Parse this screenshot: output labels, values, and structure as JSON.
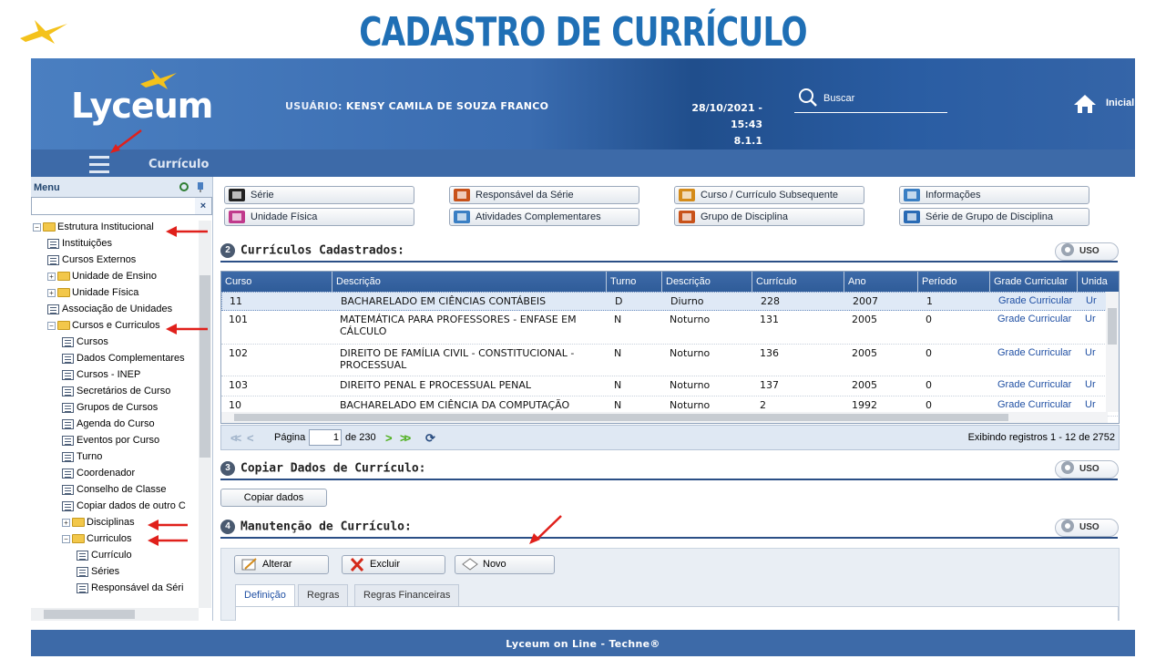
{
  "slide": {
    "title": "CADASTRO DE CURRÍCULO"
  },
  "header": {
    "brand": "Lyceum",
    "user_label": "USUÁRIO:",
    "user_name": "KENSY CAMILA DE SOUZA FRANCO",
    "datetime": "28/10/2021 - 15:43",
    "version": "8.1.1",
    "search_label": "Buscar",
    "home_label": "Inicial"
  },
  "subbar": {
    "title": "Currículo"
  },
  "sidebar": {
    "menu_label": "Menu",
    "clear_label": "×",
    "tree": [
      {
        "label": "Estrutura Institucional",
        "type": "folder",
        "level": 0,
        "expanded": true
      },
      {
        "label": "Instituições",
        "type": "doc",
        "level": 1
      },
      {
        "label": "Cursos Externos",
        "type": "doc",
        "level": 1
      },
      {
        "label": "Unidade de Ensino",
        "type": "folder",
        "level": 1,
        "expanded": false
      },
      {
        "label": "Unidade Física",
        "type": "folder",
        "level": 1,
        "expanded": false
      },
      {
        "label": "Associação de Unidades",
        "type": "doc",
        "level": 1
      },
      {
        "label": "Cursos e Curriculos",
        "type": "folder",
        "level": 1,
        "expanded": true
      },
      {
        "label": "Cursos",
        "type": "doc",
        "level": 2
      },
      {
        "label": "Dados Complementares",
        "type": "doc",
        "level": 2
      },
      {
        "label": "Cursos - INEP",
        "type": "doc",
        "level": 2
      },
      {
        "label": "Secretários de Curso",
        "type": "doc",
        "level": 2
      },
      {
        "label": "Grupos de Cursos",
        "type": "doc",
        "level": 2
      },
      {
        "label": "Agenda do Curso",
        "type": "doc",
        "level": 2
      },
      {
        "label": "Eventos por Curso",
        "type": "doc",
        "level": 2
      },
      {
        "label": "Turno",
        "type": "doc",
        "level": 2
      },
      {
        "label": "Coordenador",
        "type": "doc",
        "level": 2
      },
      {
        "label": "Conselho de Classe",
        "type": "doc",
        "level": 2
      },
      {
        "label": "Copiar dados de outro C",
        "type": "doc",
        "level": 2
      },
      {
        "label": "Disciplinas",
        "type": "folder",
        "level": 2,
        "expanded": false
      },
      {
        "label": "Curriculos",
        "type": "folder",
        "level": 2,
        "expanded": true
      },
      {
        "label": "Currículo",
        "type": "doc",
        "level": 3
      },
      {
        "label": "Séries",
        "type": "doc",
        "level": 3
      },
      {
        "label": "Responsável da Séri",
        "type": "doc",
        "level": 3
      }
    ]
  },
  "toolbar": {
    "buttons": [
      {
        "label": "Série",
        "icon": "series-icon"
      },
      {
        "label": "Responsável da Série",
        "icon": "responsible-icon"
      },
      {
        "label": "Curso / Currículo Subsequente",
        "icon": "subsequent-icon"
      },
      {
        "label": "Informações",
        "icon": "info-icon"
      },
      {
        "label": "Unidade Física",
        "icon": "building-icon"
      },
      {
        "label": "Atividades Complementares",
        "icon": "activities-icon"
      },
      {
        "label": "Grupo de Disciplina",
        "icon": "book-group-icon"
      },
      {
        "label": "Série de Grupo de Disciplina",
        "icon": "numbered-icon"
      }
    ]
  },
  "sections": {
    "registered": {
      "num": "2",
      "title": "Currículos Cadastrados:"
    },
    "copy": {
      "num": "3",
      "title": "Copiar Dados de Currículo:",
      "button": "Copiar dados"
    },
    "maintenance": {
      "num": "4",
      "title": "Manutenção de Currículo:"
    },
    "uso_label": "USO"
  },
  "table": {
    "columns": [
      "Curso",
      "Descrição",
      "Turno",
      "Descrição",
      "Currículo",
      "Ano",
      "Período",
      "Grade Curricular",
      "Unida"
    ],
    "rows": [
      [
        "11",
        "BACHARELADO EM CIÊNCIAS CONTÁBEIS",
        "D",
        "Diurno",
        "228",
        "2007",
        "1",
        "Grade Curricular",
        "Ur"
      ],
      [
        "101",
        "MATEMÁTICA PARA PROFESSORES - ENFASE EM CÁLCULO",
        "N",
        "Noturno",
        "131",
        "2005",
        "0",
        "Grade Curricular",
        "Ur"
      ],
      [
        "102",
        "DIREITO DE FAMÍLIA CIVIL - CONSTITUCIONAL - PROCESSUAL",
        "N",
        "Noturno",
        "136",
        "2005",
        "0",
        "Grade Curricular",
        "Ur"
      ],
      [
        "103",
        "DIREITO PENAL E PROCESSUAL PENAL",
        "N",
        "Noturno",
        "137",
        "2005",
        "0",
        "Grade Curricular",
        "Ur"
      ],
      [
        "10",
        "BACHARELADO EM CIÊNCIA DA COMPUTAÇÃO",
        "N",
        "Noturno",
        "2",
        "1992",
        "0",
        "Grade Curricular",
        "Ur"
      ]
    ]
  },
  "pager": {
    "page_label": "Página",
    "page_value": "1",
    "of_label": "de 230",
    "info": "Exibindo registros 1 - 12 de 2752"
  },
  "actions": {
    "alter": "Alterar",
    "delete": "Excluir",
    "new": "Novo"
  },
  "tabs": [
    "Definição",
    "Regras",
    "Regras Financeiras"
  ],
  "footer": {
    "text": "Lyceum on Line - Techne®"
  },
  "colors": {
    "title_blue": "#1f6fb5",
    "header_blue": "#3d6aa8",
    "arrow_red": "#e0201b",
    "link_blue": "#1f4fa3"
  }
}
